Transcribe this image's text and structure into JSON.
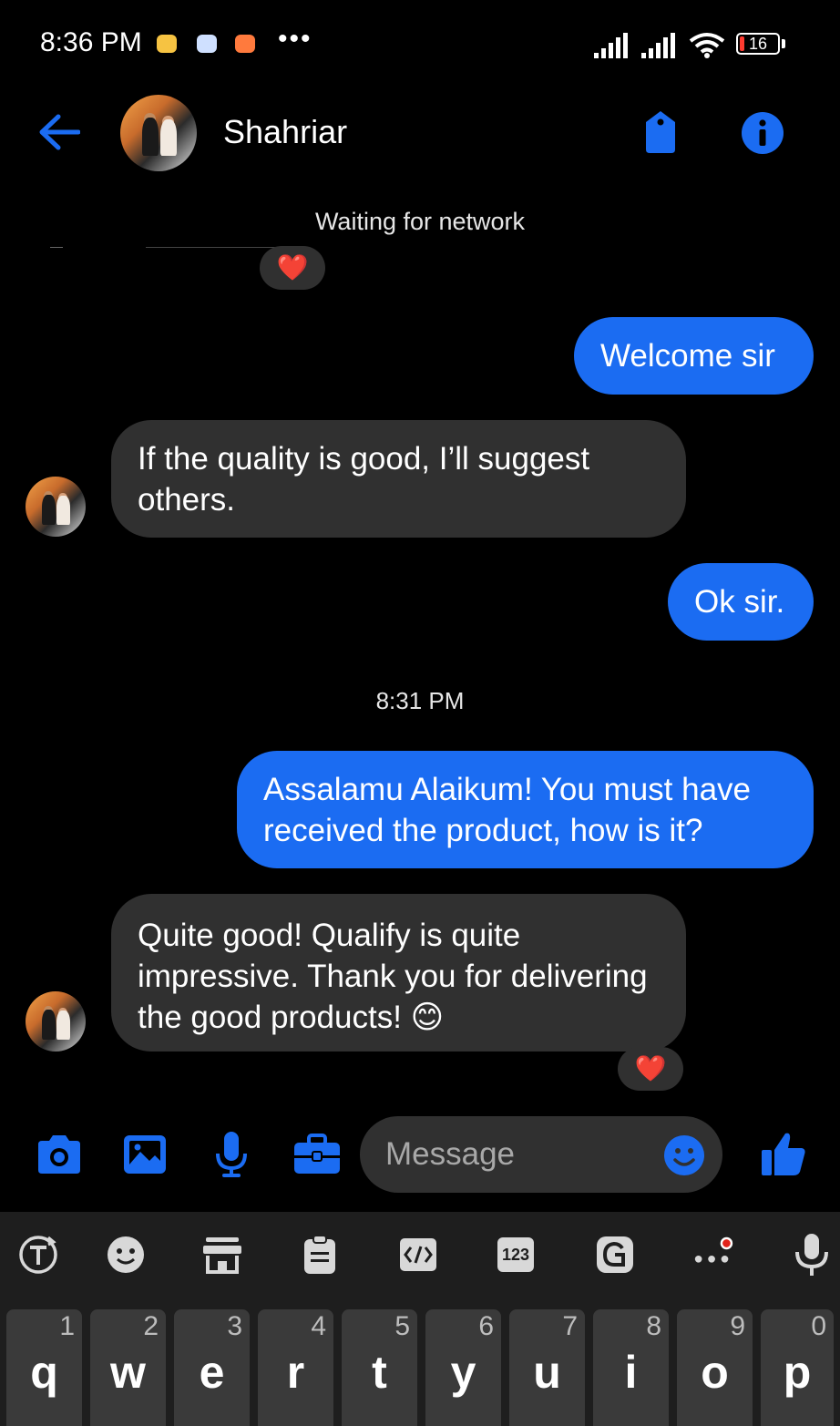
{
  "status_bar": {
    "time": "8:36 PM",
    "more": "•••",
    "battery": "16"
  },
  "header": {
    "contact_name": "Shahriar",
    "connection_status": "Waiting for network"
  },
  "reaction_emoji": "❤️",
  "messages": [
    {
      "sender": "me",
      "text": "Welcome sir"
    },
    {
      "sender": "them",
      "text": "If the quality is good, I’ll suggest others."
    },
    {
      "sender": "me",
      "text": "Ok sir."
    },
    {
      "sender": "me",
      "text": "Assalamu Alaikum! You must have received the product, how is it?"
    },
    {
      "sender": "them",
      "text": "Quite good! Qualify is quite impressive. Thank you for delivering the good products! 😊"
    }
  ],
  "timestamp": "8:31 PM",
  "composer": {
    "placeholder": "Message"
  },
  "keyboard": {
    "toolbar_123": "123",
    "keys": [
      {
        "num": "1",
        "ch": "q"
      },
      {
        "num": "2",
        "ch": "w"
      },
      {
        "num": "3",
        "ch": "e"
      },
      {
        "num": "4",
        "ch": "r"
      },
      {
        "num": "5",
        "ch": "t"
      },
      {
        "num": "6",
        "ch": "y"
      },
      {
        "num": "7",
        "ch": "u"
      },
      {
        "num": "8",
        "ch": "i"
      },
      {
        "num": "9",
        "ch": "o"
      },
      {
        "num": "0",
        "ch": "p"
      }
    ]
  },
  "colors": {
    "accent": "#1b6cf2",
    "bubble_them": "#303030",
    "background": "#000000"
  }
}
